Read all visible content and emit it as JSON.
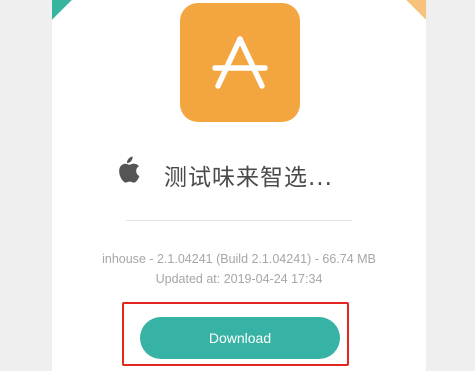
{
  "app": {
    "name": "测试味来智选...",
    "icon": "app-store-a-icon",
    "platform_icon": "apple-icon",
    "build_info": "inhouse - 2.1.04241 (Build 2.1.04241) - 66.74 MB",
    "updated": "Updated at: 2019-04-24 17:34"
  },
  "actions": {
    "download_label": "Download"
  },
  "colors": {
    "icon_bg": "#f3a640",
    "button": "#36b3a5",
    "highlight_border": "#e3261f",
    "corner_left": "#37b59f",
    "corner_right": "#f6c27c"
  }
}
